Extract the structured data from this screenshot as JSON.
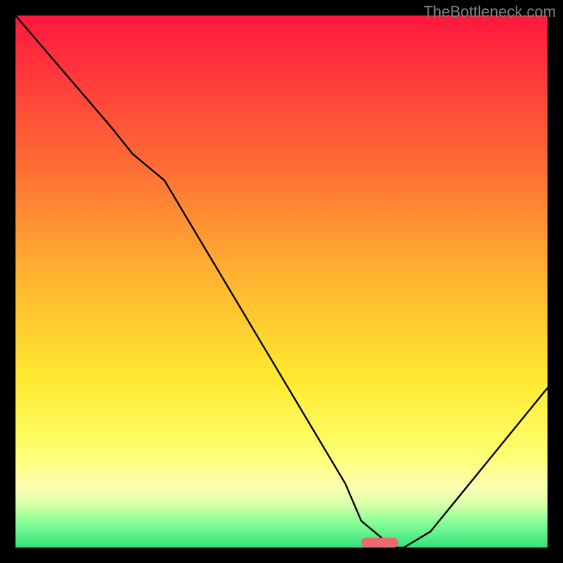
{
  "watermark": "TheBottleneck.com",
  "chart_data": {
    "type": "line",
    "title": "",
    "xlabel": "",
    "ylabel": "",
    "xlim": [
      0,
      100
    ],
    "ylim": [
      0,
      100
    ],
    "grid": false,
    "series": [
      {
        "name": "curve",
        "x": [
          0,
          18,
          22,
          28,
          62,
          65,
          71,
          73,
          78,
          100
        ],
        "values": [
          100,
          79,
          74,
          69,
          12,
          5,
          0,
          0,
          3,
          30
        ]
      }
    ],
    "marker": {
      "x_start": 65,
      "x_end": 72,
      "y": 0,
      "color": "#ea6a6d"
    },
    "gradient_stops": [
      {
        "pos": 0.0,
        "color": "#ff173f"
      },
      {
        "pos": 0.28,
        "color": "#ff6c35"
      },
      {
        "pos": 0.48,
        "color": "#ffb030"
      },
      {
        "pos": 0.68,
        "color": "#ffe92f"
      },
      {
        "pos": 0.82,
        "color": "#fdff6d"
      },
      {
        "pos": 0.89,
        "color": "#fbffb5"
      },
      {
        "pos": 0.92,
        "color": "#d6ffa7"
      },
      {
        "pos": 0.95,
        "color": "#8dff9a"
      },
      {
        "pos": 1.0,
        "color": "#32e27a"
      }
    ]
  }
}
